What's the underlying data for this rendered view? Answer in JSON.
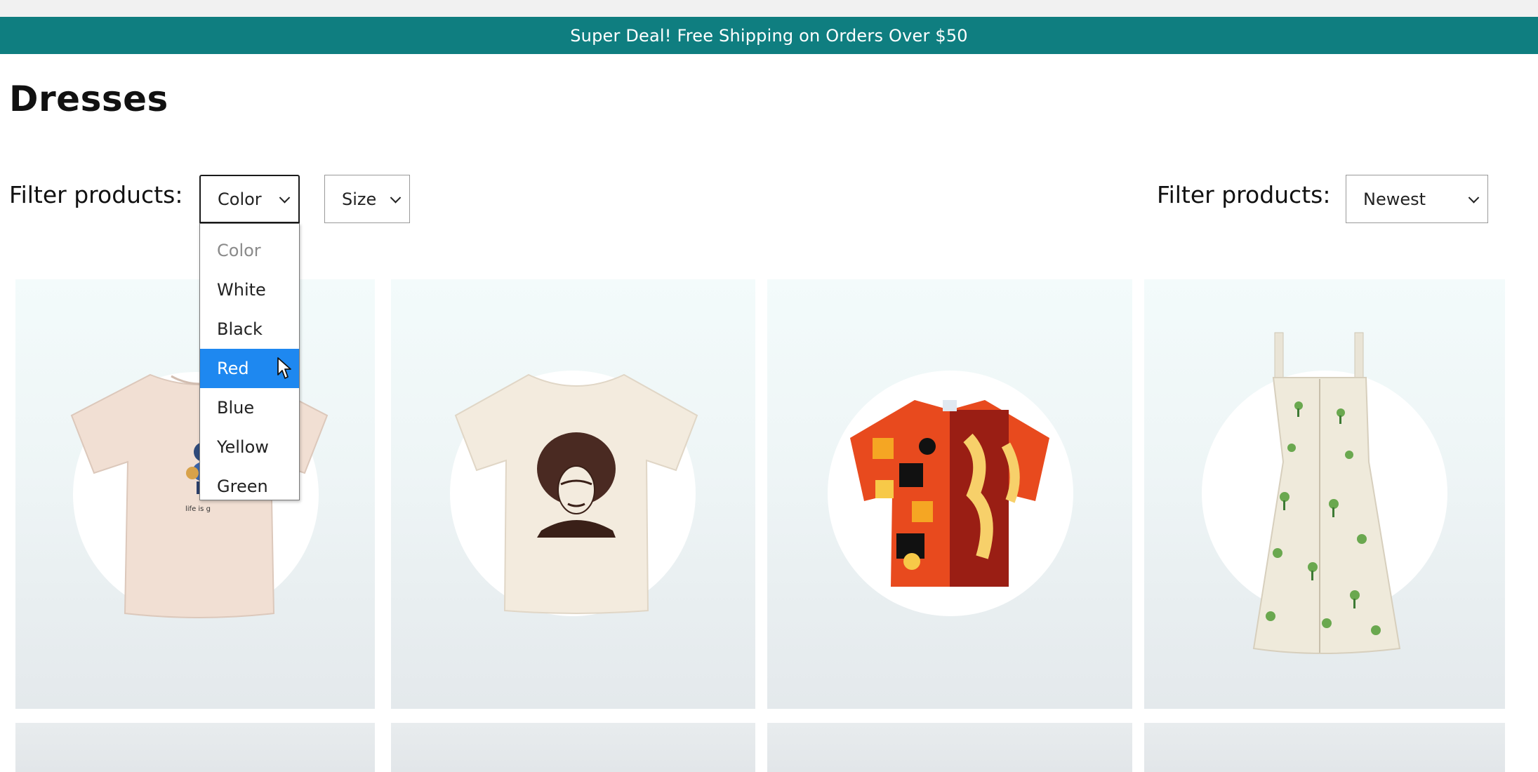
{
  "banner": {
    "text": "Super Deal! Free Shipping on Orders Over $50"
  },
  "page": {
    "title": "Dresses"
  },
  "filters": {
    "left_label": "Filter products:",
    "right_label": "Filter products:",
    "color_select": {
      "value": "Color",
      "open": true
    },
    "size_select": {
      "value": "Size"
    },
    "sort_select": {
      "value": "Newest"
    },
    "color_options": [
      "Color",
      "White",
      "Black",
      "Red",
      "Blue",
      "Yellow",
      "Green"
    ],
    "highlighted_option": "Red"
  },
  "products": [
    {
      "image": "beige-graphic-tshirt"
    },
    {
      "image": "cream-portrait-tshirt"
    },
    {
      "image": "patterned-short-sleeve-shirt"
    },
    {
      "image": "floral-print-dress"
    }
  ],
  "colors": {
    "banner": "#0f7e80",
    "highlight": "#1e88f0"
  }
}
